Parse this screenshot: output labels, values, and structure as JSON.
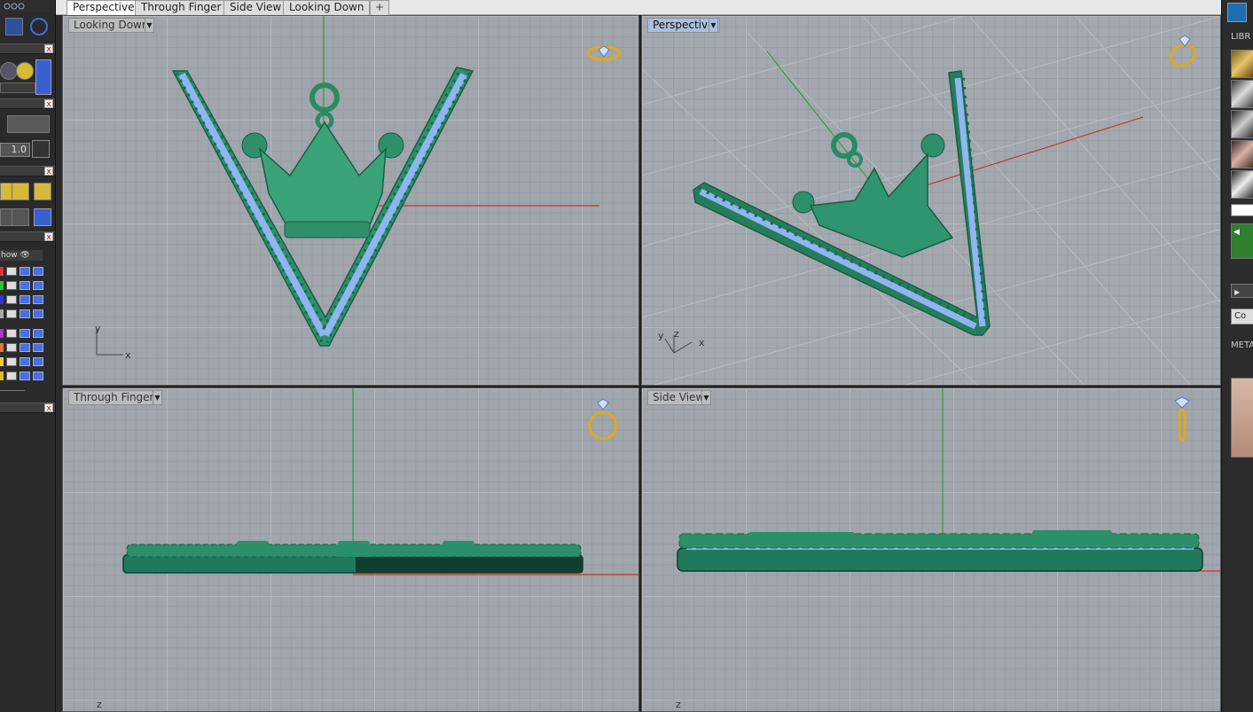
{
  "tabs": [
    {
      "label": "Perspective",
      "active": true
    },
    {
      "label": "Through Finger",
      "active": false
    },
    {
      "label": "Side View",
      "active": false
    },
    {
      "label": "Looking Down",
      "active": false
    }
  ],
  "tab_add_glyph": "+",
  "viewports": {
    "top_left": {
      "label": "Looking Down",
      "axis_x": "x",
      "axis_y": "y",
      "widget_icon": "ring-top-icon"
    },
    "top_right": {
      "label": "Perspective",
      "axis_x": "x",
      "axis_y": "y",
      "axis_z": "z",
      "widget_icon": "ring-perspective-icon"
    },
    "bottom_left": {
      "label": "Through Finger",
      "axis_z": "z",
      "widget_icon": "ring-front-icon"
    },
    "bottom_right": {
      "label": "Side View",
      "axis_z": "z",
      "widget_icon": "ring-side-icon"
    }
  },
  "left_panel": {
    "zoom_value": "1.0",
    "show_label": "how"
  },
  "right_panel": {
    "library_label": "LIBR",
    "co_button": "Co",
    "metal_label": "META"
  },
  "colors": {
    "model_green": "#1f7a5c",
    "gem_blue": "#8fb6f0",
    "axis_red": "#c0392b",
    "axis_green": "#2ea043",
    "active_label": "#a9c0db",
    "widget_gold": "#e0a81e"
  }
}
